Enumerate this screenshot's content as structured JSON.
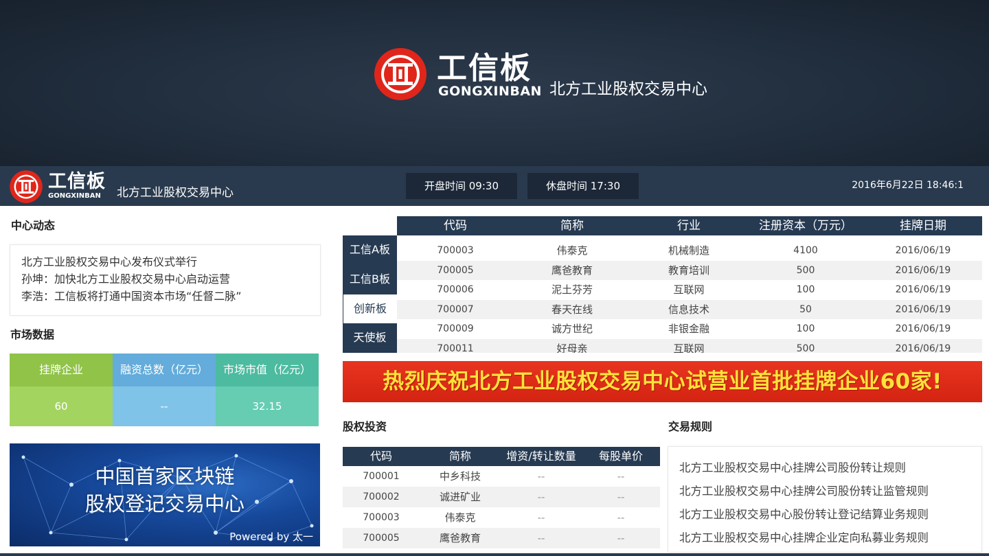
{
  "brand": {
    "name_cn": "工信板",
    "name_en": "GONGXINBAN",
    "subtitle": "北方工业股权交易中心",
    "logo_color": "#e0261b"
  },
  "topbar": {
    "open_time": "开盘时间 09:30",
    "close_time": "休盘时间 17:30",
    "datetime": "2016年6月22日 18:46:1"
  },
  "news": {
    "title": "中心动态",
    "items": [
      "北方工业股权交易中心发布仪式举行",
      "孙坤：加快北方工业股权交易中心启动运营",
      "李浩：工信板将打通中国资本市场“任督二脉”"
    ]
  },
  "market": {
    "title": "市场数据",
    "stats": [
      {
        "label": "挂牌企业",
        "value": "60",
        "color": "#90c348"
      },
      {
        "label": "融资总数（亿元）",
        "value": "--",
        "color": "#63acdb"
      },
      {
        "label": "市场市值（亿元）",
        "value": "32.15",
        "color": "#4cbba0"
      }
    ]
  },
  "banner": {
    "line1": "中国首家区块链",
    "line2": "股权登记交易中心",
    "powered": "Powered by 太一"
  },
  "listing": {
    "columns": [
      "代码",
      "简称",
      "行业",
      "注册资本（万元）",
      "挂牌日期"
    ],
    "tabs": [
      "工信A板",
      "工信B板",
      "创新板",
      "天使板"
    ],
    "active_tab": 2,
    "rows": [
      [
        "700003",
        "伟泰克",
        "机械制造",
        "4100",
        "2016/06/19"
      ],
      [
        "700005",
        "鹰爸教育",
        "教育培训",
        "500",
        "2016/06/19"
      ],
      [
        "700006",
        "泥土芬芳",
        "互联网",
        "100",
        "2016/06/19"
      ],
      [
        "700007",
        "春天在线",
        "信息技术",
        "50",
        "2016/06/19"
      ],
      [
        "700009",
        "诚方世纪",
        "非银金融",
        "100",
        "2016/06/19"
      ],
      [
        "700011",
        "好母亲",
        "互联网",
        "500",
        "2016/06/19"
      ]
    ]
  },
  "promo": {
    "text": "热烈庆祝北方工业股权交易中心试营业首批挂牌企业60家!",
    "bg_color": "#e73521",
    "text_color": "#ffe23a"
  },
  "equity": {
    "title": "股权投资",
    "columns": [
      "代码",
      "简称",
      "增资/转让数量",
      "每股单价"
    ],
    "rows": [
      [
        "700001",
        "中乡科技",
        "--",
        "--"
      ],
      [
        "700002",
        "诚进矿业",
        "--",
        "--"
      ],
      [
        "700003",
        "伟泰克",
        "--",
        "--"
      ],
      [
        "700005",
        "鹰爸教育",
        "--",
        "--"
      ]
    ]
  },
  "rules": {
    "title": "交易规则",
    "items": [
      "北方工业股权交易中心挂牌公司股份转让规则",
      "北方工业股权交易中心挂牌公司股份转让监管规则",
      "北方工业股权交易中心股份转让登记结算业务规则",
      "北方工业股权交易中心挂牌企业定向私募业务规则"
    ]
  }
}
